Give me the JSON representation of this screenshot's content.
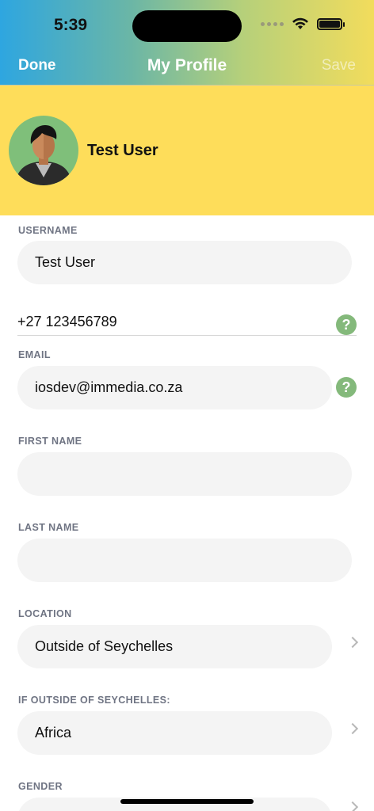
{
  "status_bar": {
    "time": "5:39"
  },
  "nav": {
    "done_label": "Done",
    "title": "My Profile",
    "save_label": "Save"
  },
  "profile": {
    "name": "Test User"
  },
  "form": {
    "username": {
      "label": "USERNAME",
      "value": "Test User"
    },
    "phone": {
      "value": "+27 123456789"
    },
    "email": {
      "label": "EMAIL",
      "value": "iosdev@immedia.co.za"
    },
    "first_name": {
      "label": "FIRST NAME",
      "value": ""
    },
    "last_name": {
      "label": "LAST NAME",
      "value": ""
    },
    "location": {
      "label": "LOCATION",
      "value": "Outside of Seychelles"
    },
    "outside": {
      "label": "IF OUTSIDE OF SEYCHELLES:",
      "value": "Africa"
    },
    "gender": {
      "label": "GENDER",
      "value": ""
    }
  },
  "help_glyph": "?",
  "colors": {
    "header_yellow": "#fedd5a",
    "help_green": "#84b97b",
    "field_bg": "#f4f4f4",
    "label_gray": "#6f7483"
  }
}
